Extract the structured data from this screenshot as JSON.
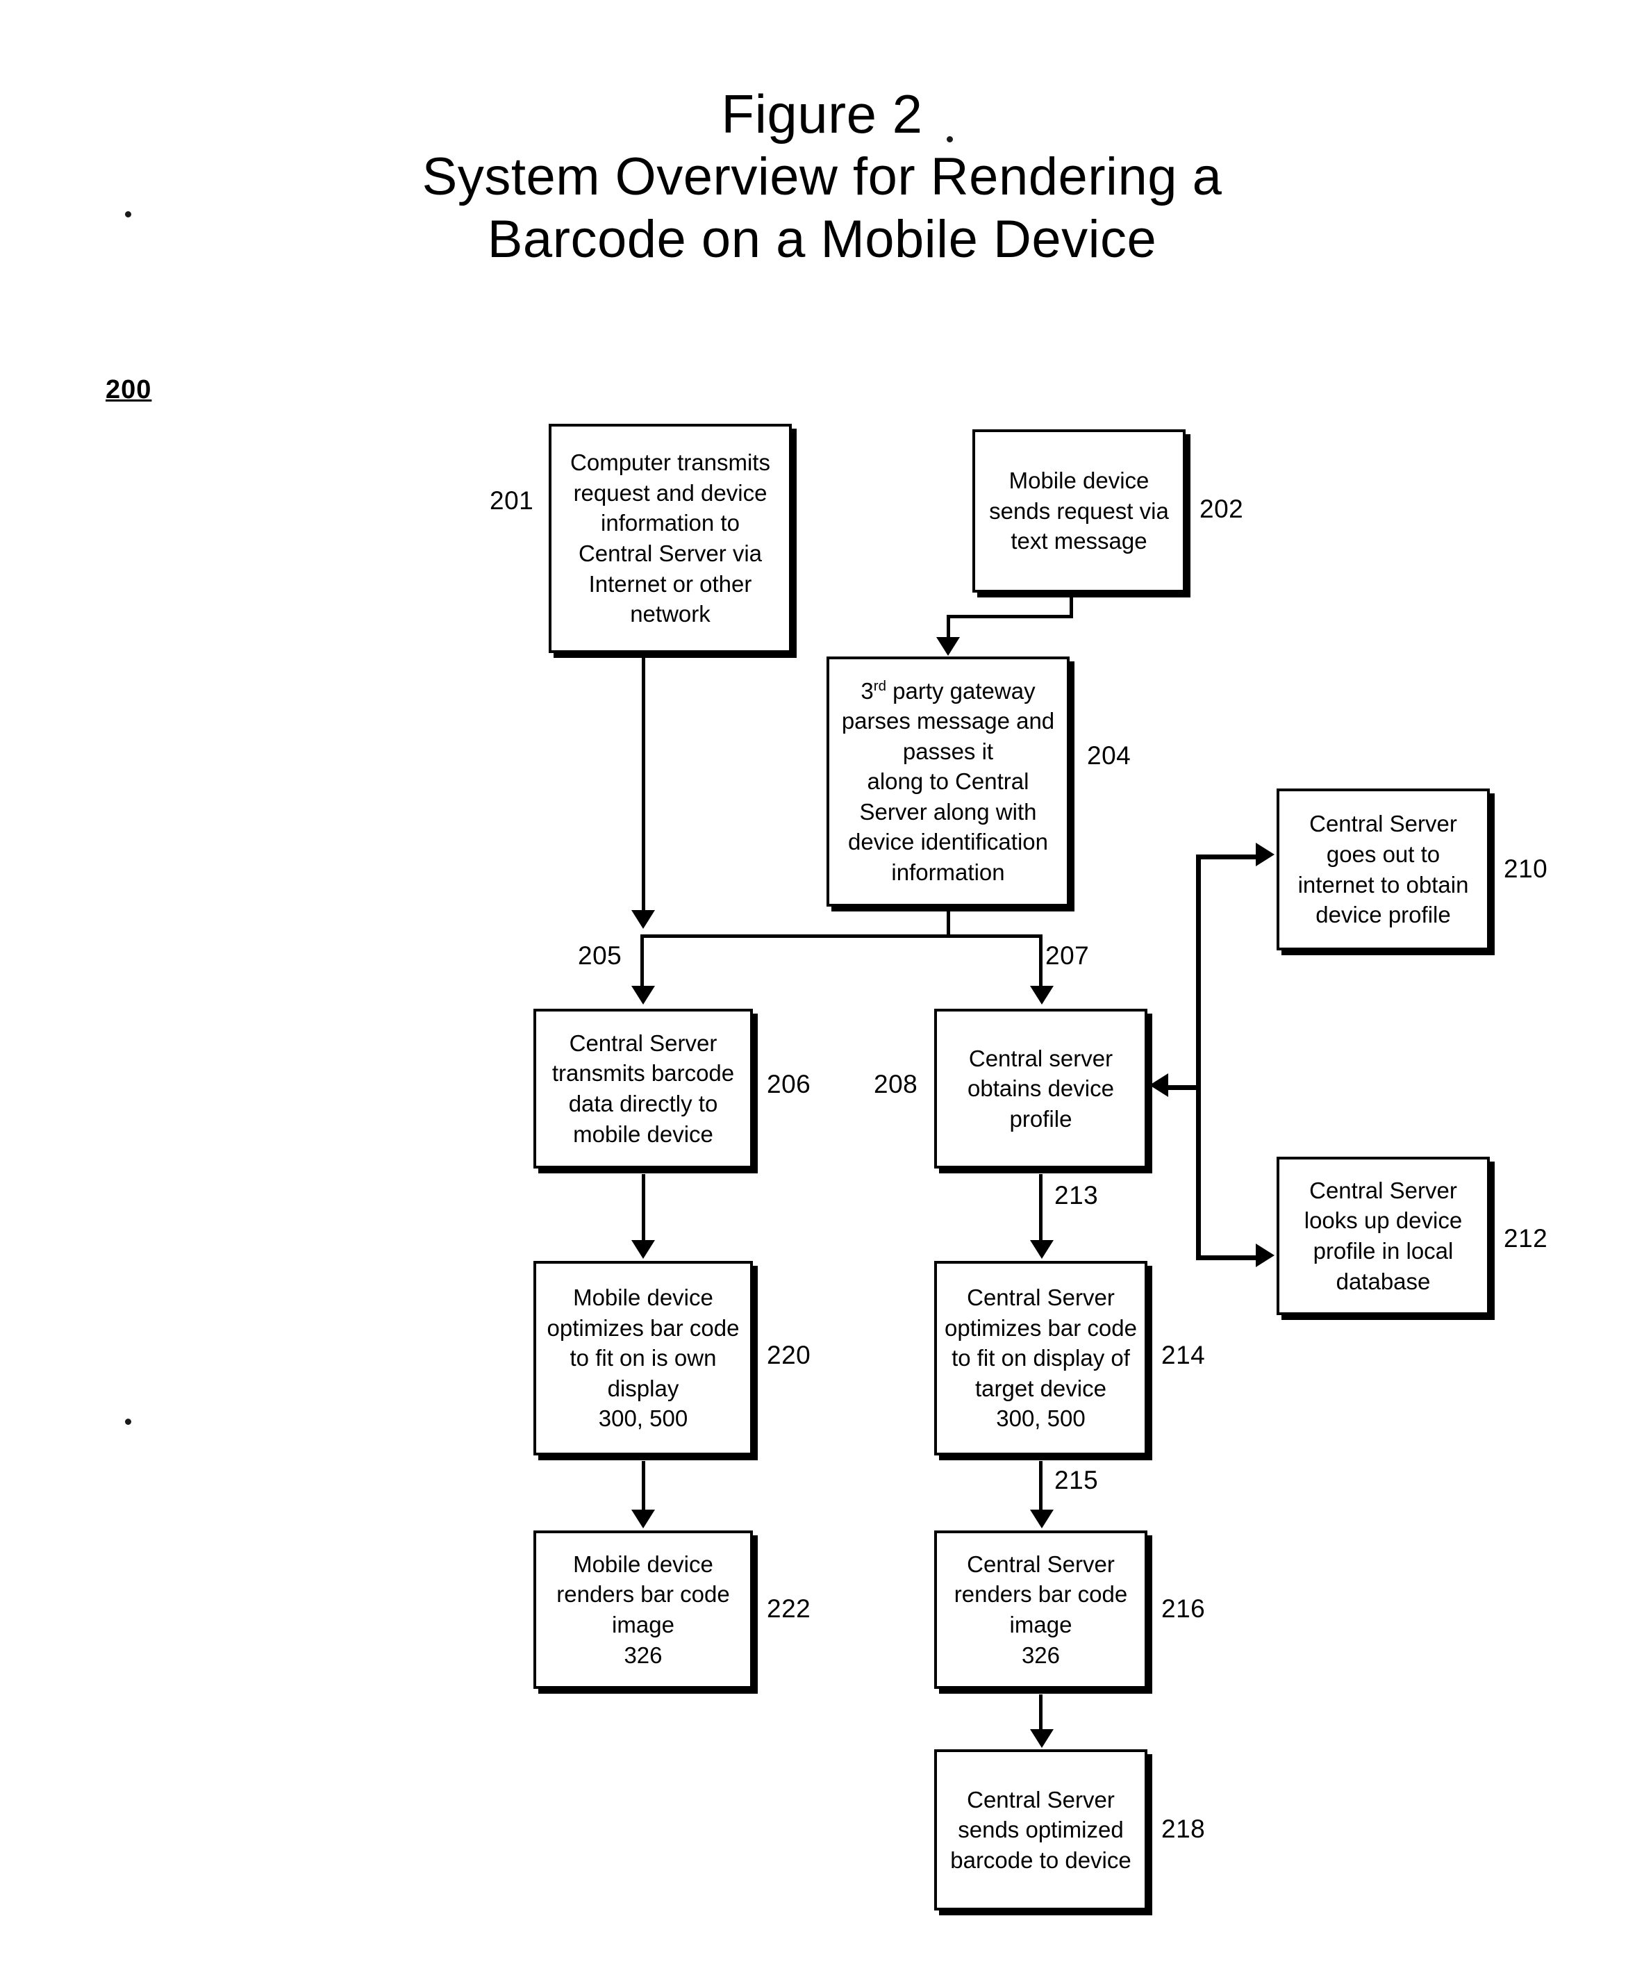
{
  "title": {
    "line1": "Figure 2",
    "line2": "System Overview for Rendering a",
    "line3": "Barcode on a Mobile Device"
  },
  "figure_ref": "200",
  "boxes": [
    {
      "id": "201",
      "ref": "201",
      "ref_side": "left",
      "text": "Computer transmits\nrequest and device\ninformation to\nCentral Server via\nInternet or other\nnetwork"
    },
    {
      "id": "202",
      "ref": "202",
      "ref_side": "right",
      "text": "Mobile device\nsends request via\ntext message"
    },
    {
      "id": "204",
      "ref": "204",
      "ref_side": "right",
      "text_pre": "3",
      "text_sup": "rd",
      "text_post": " party gateway\nparses message and\npasses it\nalong to Central\nServer along with\ndevice identification\ninformation"
    },
    {
      "id": "210",
      "ref": "210",
      "ref_side": "right",
      "text": "Central Server\ngoes out to\ninternet to obtain\ndevice profile"
    },
    {
      "id": "206",
      "ref": "206",
      "ref_side": "right",
      "text": "Central Server\ntransmits barcode\ndata directly to\nmobile device"
    },
    {
      "id": "208",
      "ref": "208",
      "ref_side": "left",
      "text": "Central server\nobtains device\nprofile"
    },
    {
      "id": "212",
      "ref": "212",
      "ref_side": "right",
      "text": "Central Server\nlooks up device\nprofile in local\ndatabase"
    },
    {
      "id": "220",
      "ref": "220",
      "ref_side": "right",
      "text": "Mobile device\noptimizes bar code\nto fit on is own\ndisplay\n300, 500"
    },
    {
      "id": "214",
      "ref": "214",
      "ref_side": "right",
      "text": "Central Server\noptimizes bar code\nto fit on display of\ntarget device\n300, 500"
    },
    {
      "id": "222",
      "ref": "222",
      "ref_side": "right",
      "text": "Mobile device\nrenders bar code\nimage\n326"
    },
    {
      "id": "216",
      "ref": "216",
      "ref_side": "right",
      "text": "Central Server\nrenders bar code\nimage\n326"
    },
    {
      "id": "218",
      "ref": "218",
      "ref_side": "right",
      "text": "Central Server\nsends optimized\nbarcode to device"
    }
  ],
  "connector_labels": {
    "l205": "205",
    "l207": "207",
    "l213": "213",
    "l215": "215"
  },
  "colors": {
    "ink": "#000000",
    "paper": "#ffffff"
  }
}
